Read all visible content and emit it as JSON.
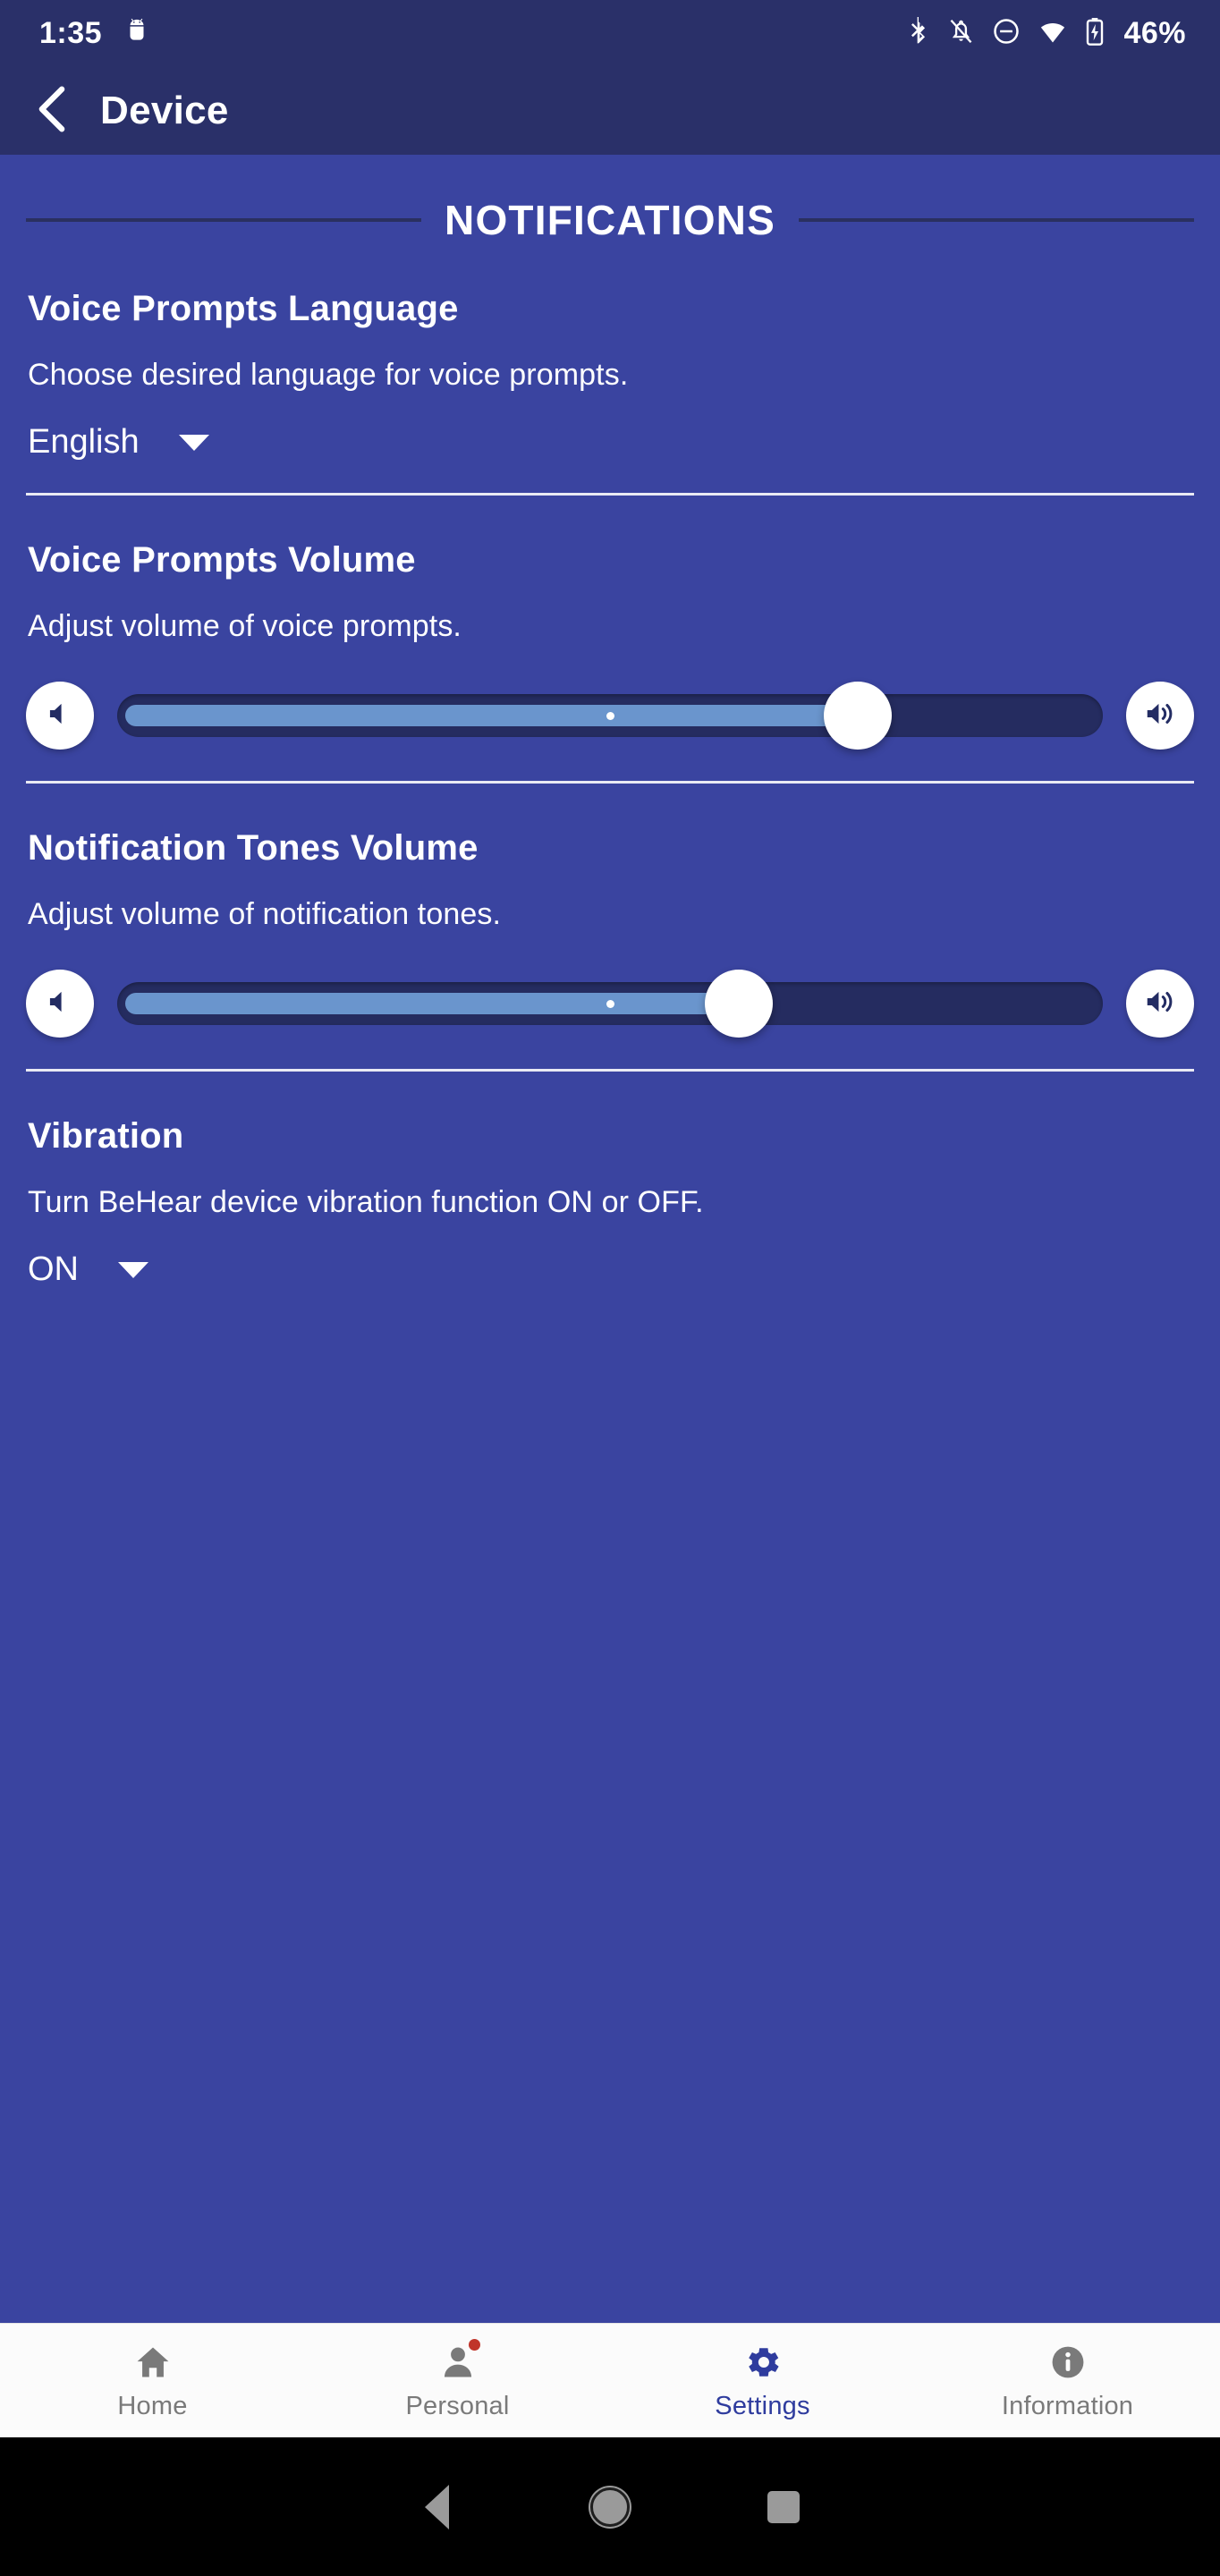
{
  "status_bar": {
    "time": "1:35",
    "battery_percent": "46%",
    "icons": [
      "android-debug-icon",
      "bluetooth-icon",
      "notifications-muted-icon",
      "do-not-disturb-icon",
      "wifi-icon",
      "battery-charging-icon"
    ]
  },
  "app_bar": {
    "back_icon": "chevron-left-icon",
    "title": "Device"
  },
  "section": {
    "header": "NOTIFICATIONS"
  },
  "blocks": [
    {
      "title": "Voice Prompts Language",
      "description": "Choose desired language for voice prompts.",
      "control": "dropdown",
      "value": "English"
    },
    {
      "title": "Voice Prompts Volume",
      "description": "Adjust volume of voice prompts.",
      "control": "slider",
      "value_percent": 77,
      "min_icon": "volume-low-icon",
      "max_icon": "volume-high-icon"
    },
    {
      "title": "Notification Tones Volume",
      "description": "Adjust volume of notification tones.",
      "control": "slider",
      "value_percent": 64,
      "min_icon": "volume-low-icon",
      "max_icon": "volume-high-icon"
    },
    {
      "title": "Vibration",
      "description": "Turn BeHear device vibration function ON or OFF.",
      "control": "dropdown",
      "value": "ON"
    }
  ],
  "bottom_nav": {
    "items": [
      {
        "label": "Home",
        "icon": "home-icon",
        "active": false,
        "badge": false
      },
      {
        "label": "Personal",
        "icon": "person-icon",
        "active": false,
        "badge": true
      },
      {
        "label": "Settings",
        "icon": "gear-icon",
        "active": true,
        "badge": false
      },
      {
        "label": "Information",
        "icon": "info-circle-icon",
        "active": false,
        "badge": false
      }
    ]
  },
  "android_nav": {
    "back": "triangle-back-icon",
    "home": "circle-home-icon",
    "recents": "square-recents-icon"
  },
  "colors": {
    "background": "#3a44a0",
    "app_bar": "#2a3069",
    "accent": "#2f3c9e",
    "slider_fill": "#6a95cd",
    "slider_track": "#252c60",
    "badge": "#c0342a"
  }
}
